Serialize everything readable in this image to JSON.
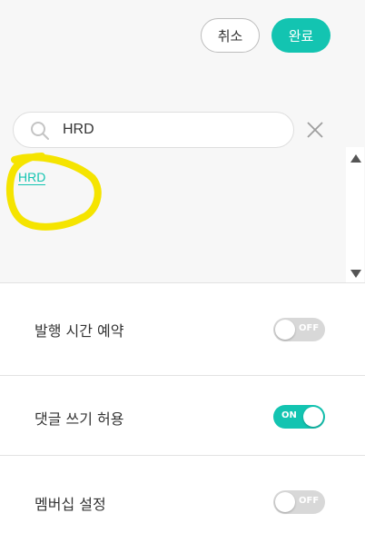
{
  "header": {
    "cancel_label": "취소",
    "done_label": "완료"
  },
  "search": {
    "value": "HRD",
    "icon": "search-icon",
    "clear_icon": "close-icon"
  },
  "results": [
    {
      "label": "HRD"
    }
  ],
  "settings": [
    {
      "label": "발행 시간 예약",
      "state": "OFF"
    },
    {
      "label": "댓글 쓰기 허용",
      "state": "ON"
    },
    {
      "label": "멤버십 설정",
      "state": "OFF"
    }
  ],
  "colors": {
    "accent": "#13c4b1",
    "highlight": "#f5e400",
    "toggle_off": "#d8d8d8"
  }
}
